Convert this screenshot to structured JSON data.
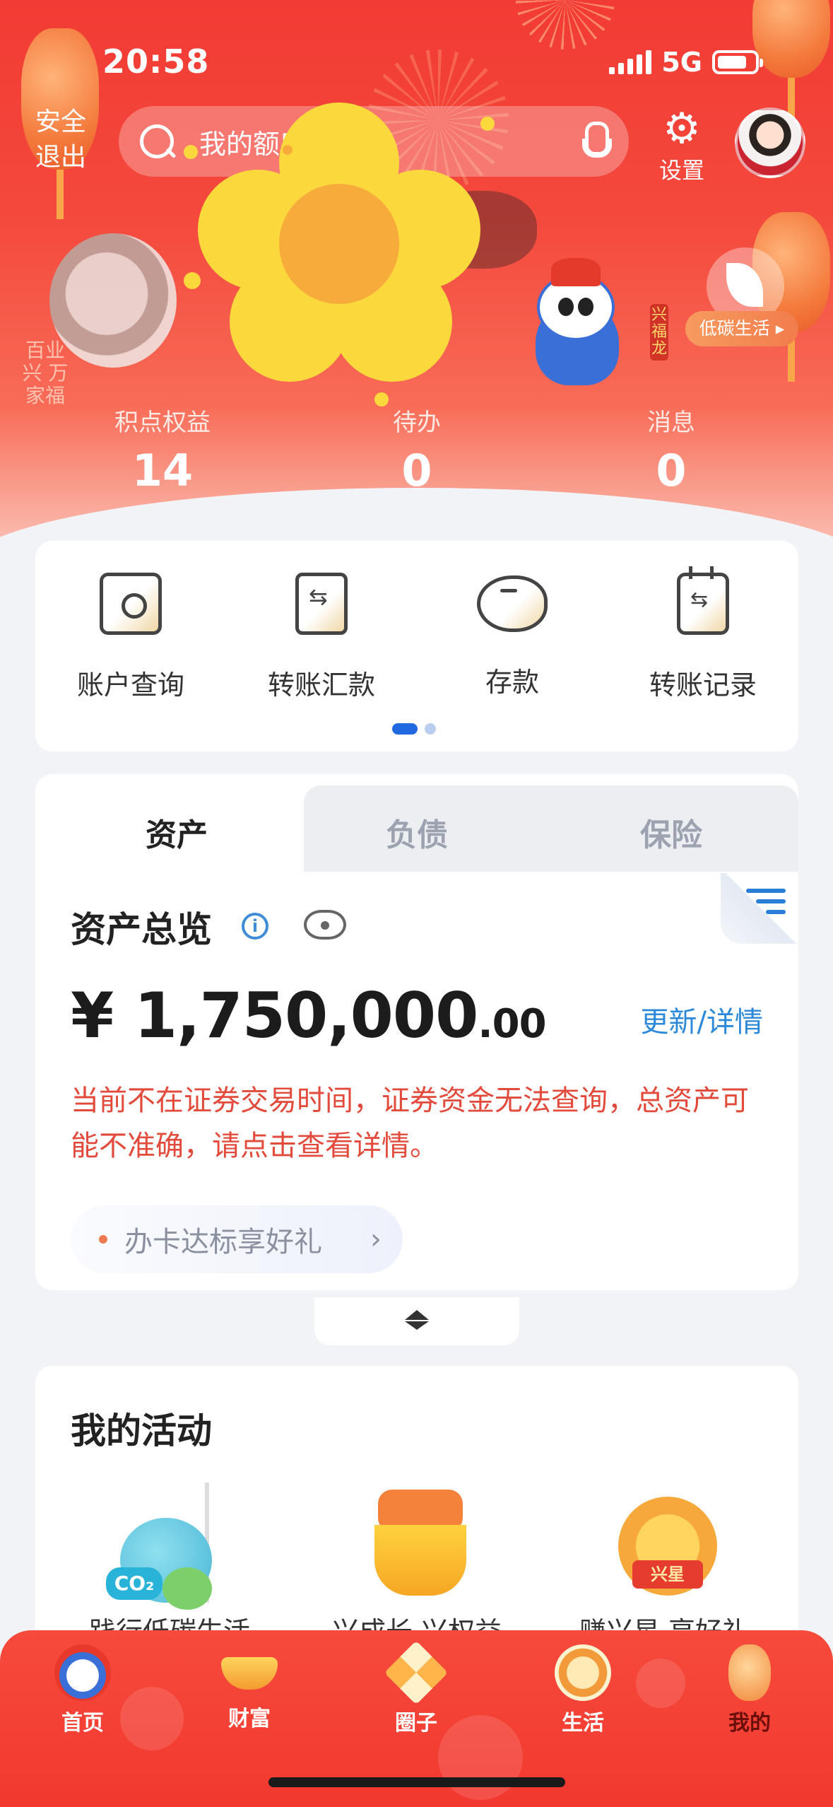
{
  "status_bar": {
    "time": "20:58",
    "network": "5G"
  },
  "header": {
    "logout_label": "安全\n退出",
    "search_placeholder": "我的额度",
    "settings_label": "设置",
    "low_carbon_label": "低碳生活",
    "mascot_tag": "兴福龙",
    "vertical_slogan": "百业兴 万家福"
  },
  "stats": [
    {
      "label": "积点权益",
      "value": "14"
    },
    {
      "label": "待办",
      "value": "0"
    },
    {
      "label": "消息",
      "value": "0"
    }
  ],
  "quick_actions": [
    {
      "label": "账户查询",
      "icon": "wallet-icon"
    },
    {
      "label": "转账汇款",
      "icon": "transfer-icon"
    },
    {
      "label": "存款",
      "icon": "piggy-bank-icon"
    },
    {
      "label": "转账记录",
      "icon": "transfer-record-icon"
    }
  ],
  "asset_tabs": {
    "assets": "资产",
    "liabilities": "负债",
    "insurance": "保险"
  },
  "overview": {
    "title": "资产总览",
    "currency": "¥",
    "amount_main": "1,750,000",
    "amount_decimal": ".00",
    "update_link": "更新/详情",
    "warning": "当前不在证券交易时间，证券资金无法查询，总资产可能不准确，请点击查看详情。",
    "promo": "办卡达标享好礼"
  },
  "activities": {
    "title": "我的活动",
    "items": [
      {
        "label": "践行低碳生活",
        "badge": "CO₂"
      },
      {
        "label": "兴成长 兴权益",
        "badge": ""
      },
      {
        "label": "赚兴星 享好礼",
        "badge": "兴星"
      }
    ]
  },
  "bottom_nav": [
    {
      "label": "首页"
    },
    {
      "label": "财富"
    },
    {
      "label": "圈子"
    },
    {
      "label": "生活"
    },
    {
      "label": "我的"
    }
  ],
  "colors": {
    "brand_red": "#f23b34",
    "link_blue": "#2c89d9",
    "warning_red": "#e24a3b",
    "flower_yellow": "#fbd93d",
    "flower_center": "#f7ab3b"
  }
}
